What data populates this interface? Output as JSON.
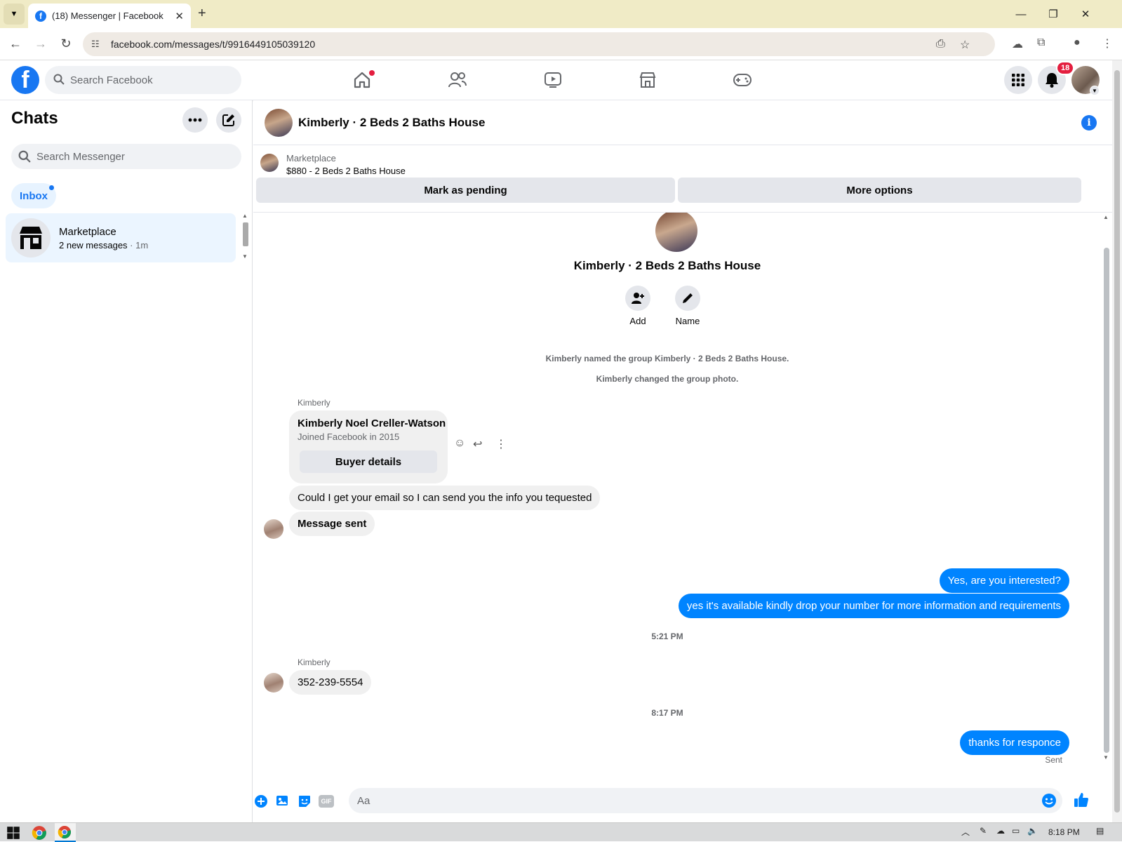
{
  "browser": {
    "tab_title": "(18) Messenger | Facebook",
    "tab_icon": "f",
    "new_tab": "+",
    "url": "facebook.com/messages/t/9916449105039120",
    "window_controls": {
      "minimize": "—",
      "restore": "❐",
      "close": "✕"
    },
    "tab_close": "✕"
  },
  "fb_header": {
    "logo": "f",
    "search_placeholder": "Search Facebook",
    "notifications_count": "18"
  },
  "sidebar": {
    "title": "Chats",
    "search_placeholder": "Search Messenger",
    "filter_label": "Inbox",
    "chats": [
      {
        "name": "Marketplace",
        "preview": "2 new messages",
        "time": " · 1m"
      }
    ]
  },
  "conversation": {
    "title": "Kimberly · 2 Beds 2 Baths House",
    "marketplace_label": "Marketplace",
    "marketplace_item": "$880 - 2 Beds 2 Baths House",
    "mark_pending_label": "Mark as pending",
    "more_options_label": "More options",
    "group_name": "Kimberly · 2 Beds 2 Baths House",
    "add_label": "Add",
    "name_label": "Name",
    "system_messages": [
      "Kimberly named the group Kimberly · 2 Beds 2 Baths House.",
      "Kimberly changed the group photo."
    ],
    "sender_name": "Kimberly",
    "buyer_card": {
      "name": "Kimberly Noel Creller-Watson",
      "joined": "Joined Facebook in 2015",
      "button": "Buyer details"
    },
    "incoming_1": "Could I get your email so I can send you the info you tequested",
    "incoming_2": "Message sent",
    "outgoing_1": "Yes, are you interested?",
    "outgoing_2": "yes it's available kindly drop your number for more information and requirements",
    "timestamp_1": "5:21 PM",
    "sender_name_2": "Kimberly",
    "incoming_3": "352-239-5554",
    "timestamp_2": "8:17 PM",
    "outgoing_3": "thanks for responce",
    "sent_status": "Sent",
    "composer_placeholder": "Aa",
    "gif_label": "GIF"
  },
  "taskbar": {
    "clock": "8:18 PM"
  },
  "colors": {
    "brand": "#1877f2",
    "outgoing_bubble": "#0084ff",
    "notification_badge": "#e41e3f"
  }
}
